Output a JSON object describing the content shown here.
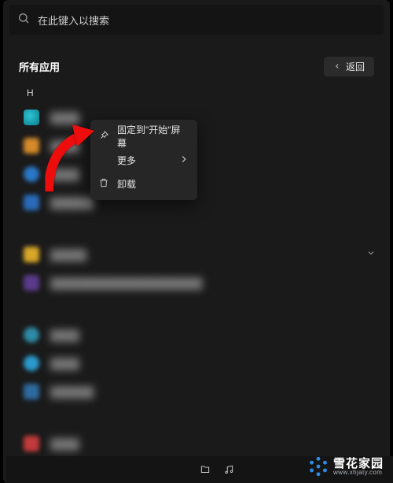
{
  "search": {
    "placeholder": "在此键入以搜索"
  },
  "header": {
    "title": "所有应用",
    "back_label": "返回"
  },
  "section_letter": "H",
  "context_menu": {
    "pin_label": "固定到\"开始\"屏幕",
    "more_label": "更多",
    "uninstall_label": "卸载"
  },
  "watermark": {
    "name": "雪花家园",
    "url": "www.xhjaty.com"
  }
}
